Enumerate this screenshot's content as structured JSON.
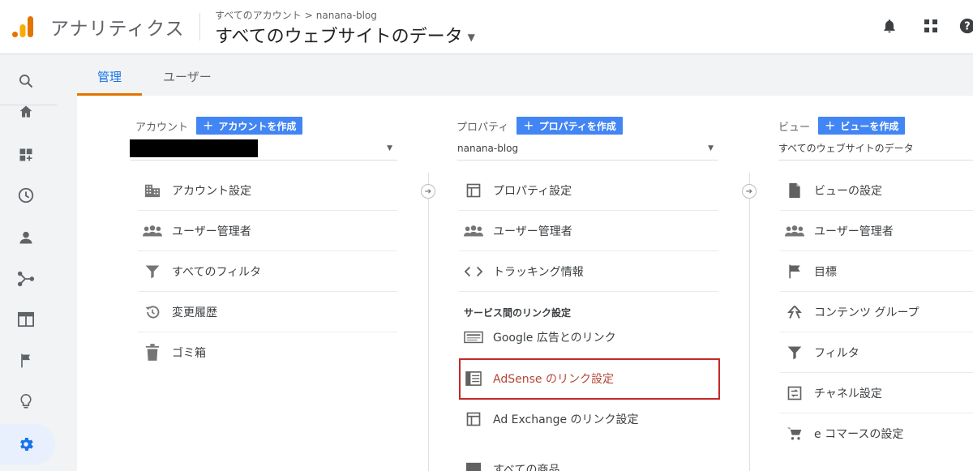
{
  "header": {
    "app_title": "アナリティクス",
    "breadcrumb_all": "すべてのアカウント",
    "breadcrumb_sep": ">",
    "breadcrumb_property": "nanana-blog",
    "view_title": "すべてのウェブサイトのデータ",
    "icons": [
      "bell-icon",
      "apps-grid-icon",
      "help-icon"
    ]
  },
  "sidebar": {
    "icons": [
      "search-icon",
      "home-icon",
      "customization-icon",
      "realtime-clock-icon",
      "audience-person-icon",
      "acquisition-icon",
      "behavior-icon",
      "conversions-flag-icon",
      "discover-lightbulb-icon",
      "admin-gear-icon"
    ]
  },
  "tabs": {
    "admin": "管理",
    "user": "ユーザー"
  },
  "account": {
    "label": "アカウント",
    "create_button": "アカウントを作成",
    "items": [
      {
        "label": "アカウント設定",
        "icon": "building-icon"
      },
      {
        "label": "ユーザー管理者",
        "icon": "people-icon"
      },
      {
        "label": "すべてのフィルタ",
        "icon": "filter-icon"
      },
      {
        "label": "変更履歴",
        "icon": "history-icon"
      },
      {
        "label": "ゴミ箱",
        "icon": "trash-icon"
      }
    ]
  },
  "property": {
    "label": "プロパティ",
    "create_button": "プロパティを作成",
    "selected": "nanana-blog",
    "items": [
      {
        "label": "プロパティ設定",
        "icon": "window-icon"
      },
      {
        "label": "ユーザー管理者",
        "icon": "people-icon"
      },
      {
        "label": "トラッキング情報",
        "icon": "code-icon"
      }
    ],
    "section_label": "サービス間のリンク設定",
    "link_items": [
      {
        "label": "Google 広告とのリンク",
        "icon": "ads-icon"
      },
      {
        "label": "AdSense のリンク設定",
        "icon": "adsense-icon"
      },
      {
        "label": "Ad Exchange のリンク設定",
        "icon": "window-icon"
      },
      {
        "label": "すべての商品",
        "icon": "products-icon"
      }
    ]
  },
  "view": {
    "label": "ビュー",
    "create_button": "ビューを作成",
    "selected": "すべてのウェブサイトのデータ",
    "items": [
      {
        "label": "ビューの設定",
        "icon": "document-icon"
      },
      {
        "label": "ユーザー管理者",
        "icon": "people-icon"
      },
      {
        "label": "目標",
        "icon": "flag-icon"
      },
      {
        "label": "コンテンツ グループ",
        "icon": "content-group-icon"
      },
      {
        "label": "フィルタ",
        "icon": "filter-icon"
      },
      {
        "label": "チャネル設定",
        "icon": "channel-icon"
      },
      {
        "label": "e コマースの設定",
        "icon": "cart-icon"
      }
    ]
  },
  "colors": {
    "accent_blue": "#4285f4",
    "tab_blue": "#1a73e8",
    "tab_underline": "#e37400",
    "highlight_red": "#c62828"
  }
}
